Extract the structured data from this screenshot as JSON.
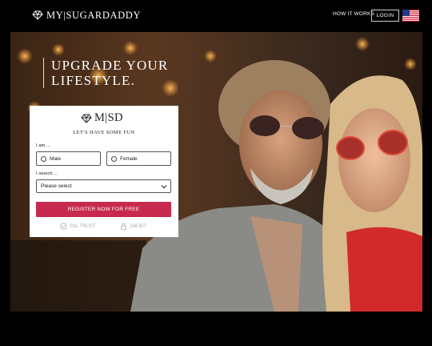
{
  "header": {
    "logo_text": "MY|SUGARDADDY",
    "nav_how": "HOW IT WORKS",
    "nav_login": "LOGIN",
    "flag_icon": "us-flag-icon"
  },
  "hero": {
    "headline_line1": "UPGRADE YOUR",
    "headline_line2": "LIFESTYLE."
  },
  "form": {
    "logo_text": "M|SD",
    "tagline": "LET'S HAVE SOME FUN",
    "iam_label": "I am ...",
    "options": [
      "Male",
      "Female"
    ],
    "isearch_label": "I search ...",
    "select_value": "Please select",
    "register_label": "REGISTER NOW FOR FREE",
    "trust_ssl": "SSL TRUST",
    "trust_bit": "256 BIT"
  },
  "colors": {
    "accent": "#c8294e",
    "background": "#000000",
    "card": "#ffffff"
  }
}
